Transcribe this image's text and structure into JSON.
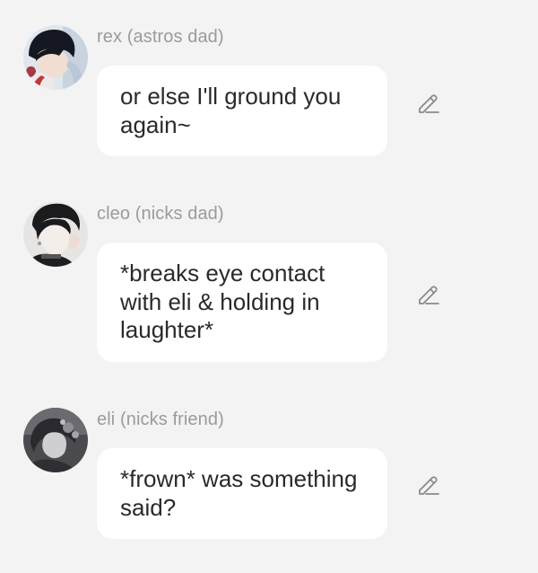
{
  "messages": [
    {
      "author": "rex (astros dad)",
      "text": "or else I'll ground you again~",
      "avatar_icon": "avatar-rex"
    },
    {
      "author": "cleo (nicks dad)",
      "text": "*breaks eye contact with eli & holding in laughter*",
      "avatar_icon": "avatar-cleo"
    },
    {
      "author": "eli (nicks friend)",
      "text": "*frown* was something said?",
      "avatar_icon": "avatar-eli"
    }
  ],
  "icons": {
    "edit": "pencil-icon"
  },
  "colors": {
    "background": "#f3f3f3",
    "bubble": "#ffffff",
    "author_text": "#9b9b9b",
    "message_text": "#2a2a2a",
    "edit_icon": "#8a8a8a"
  }
}
